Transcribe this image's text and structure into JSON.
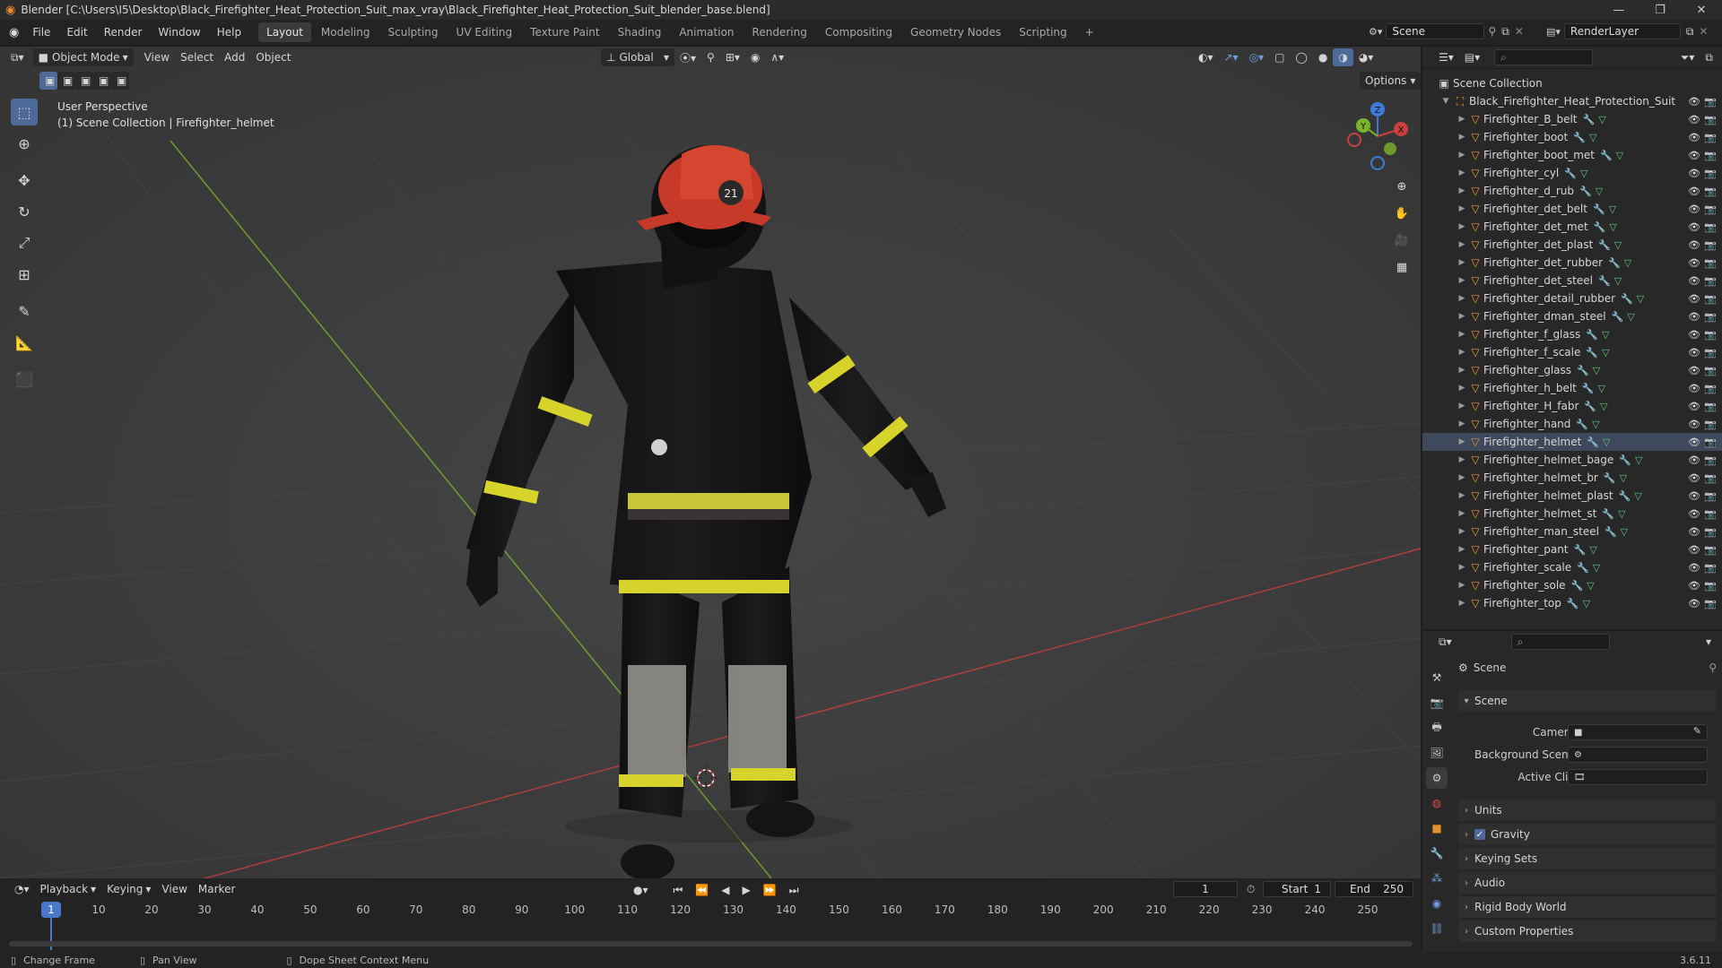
{
  "window": {
    "title": "Blender [C:\\Users\\I5\\Desktop\\Black_Firefighter_Heat_Protection_Suit_max_vray\\Black_Firefighter_Heat_Protection_Suit_blender_base.blend]",
    "minimize": "—",
    "maximize": "❐",
    "close": "✕"
  },
  "menu": [
    "File",
    "Edit",
    "Render",
    "Window",
    "Help"
  ],
  "workspaces": [
    "Layout",
    "Modeling",
    "Sculpting",
    "UV Editing",
    "Texture Paint",
    "Shading",
    "Animation",
    "Rendering",
    "Compositing",
    "Geometry Nodes",
    "Scripting"
  ],
  "add_workspace": "+",
  "scene_selector": "Scene",
  "view_layer": "RenderLayer",
  "viewport": {
    "mode": "Object Mode",
    "menus": [
      "View",
      "Select",
      "Add",
      "Object"
    ],
    "orientation": "Global",
    "options": "Options",
    "overlay_line1": "User Perspective",
    "overlay_line2": "(1) Scene Collection | Firefighter_helmet",
    "gizmo": {
      "x": "X",
      "y": "Y",
      "z": "Z"
    }
  },
  "outliner": {
    "root": "Scene Collection",
    "collection": "Black_Firefighter_Heat_Protection_Suit",
    "selected": "Firefighter_helmet",
    "objects": [
      "Firefighter_B_belt",
      "Firefighter_boot",
      "Firefighter_boot_met",
      "Firefighter_cyl",
      "Firefighter_d_rub",
      "Firefighter_det_belt",
      "Firefighter_det_met",
      "Firefighter_det_plast",
      "Firefighter_det_rubber",
      "Firefighter_det_steel",
      "Firefighter_detail_rubber",
      "Firefighter_dman_steel",
      "Firefighter_f_glass",
      "Firefighter_f_scale",
      "Firefighter_glass",
      "Firefighter_h_belt",
      "Firefighter_H_fabr",
      "Firefighter_hand",
      "Firefighter_helmet",
      "Firefighter_helmet_bage",
      "Firefighter_helmet_br",
      "Firefighter_helmet_plast",
      "Firefighter_helmet_st",
      "Firefighter_man_steel",
      "Firefighter_pant",
      "Firefighter_scale",
      "Firefighter_sole",
      "Firefighter_top"
    ]
  },
  "properties": {
    "header": "Scene",
    "section": "Scene",
    "camera_label": "Camera",
    "bg_scene_label": "Background Scene",
    "active_clip_label": "Active Clip",
    "panels": [
      "Units",
      "Gravity",
      "Keying Sets",
      "Audio",
      "Rigid Body World",
      "Custom Properties"
    ],
    "gravity_checked": true
  },
  "timeline": {
    "menus": [
      "Playback",
      "Keying",
      "View",
      "Marker"
    ],
    "current_frame": "1",
    "start_label": "Start",
    "start": "1",
    "end_label": "End",
    "end": "250",
    "ticks": [
      "1",
      "10",
      "20",
      "30",
      "40",
      "50",
      "60",
      "70",
      "80",
      "90",
      "100",
      "110",
      "120",
      "130",
      "140",
      "150",
      "160",
      "170",
      "180",
      "190",
      "200",
      "210",
      "220",
      "230",
      "240",
      "250"
    ]
  },
  "status": {
    "left": "Change Frame",
    "middle": "Pan View",
    "right": "Dope Sheet Context Menu",
    "version": "3.6.11"
  },
  "helmet_badge": "21",
  "colors": {
    "accent": "#4d6a99",
    "object_icon": "#e6912b",
    "x_axis": "#c9403f",
    "y_axis": "#7db32c",
    "z_axis": "#3f7ad6",
    "frame_marker": "#4a78c9"
  }
}
